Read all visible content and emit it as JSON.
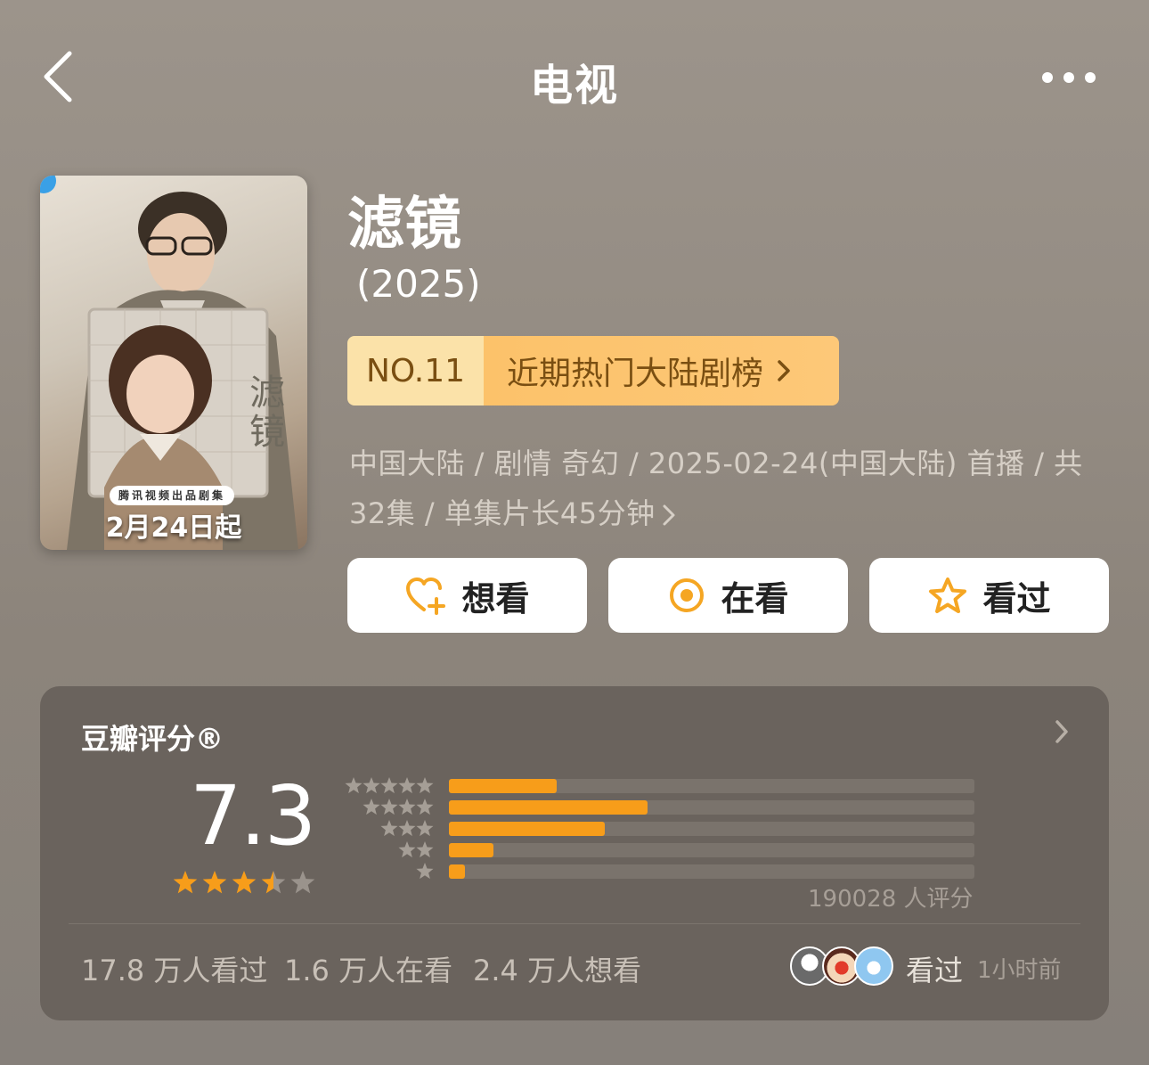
{
  "header": {
    "title": "电视",
    "back_icon": "chevron-left-icon",
    "more_icon": "more-dots-icon"
  },
  "poster": {
    "title_art": "滤镜",
    "tag": "腾讯视频出品剧集",
    "date_text": "2月24日起"
  },
  "show": {
    "title": "滤镜",
    "year": "(2025)",
    "rank": {
      "no": "NO.11",
      "label": "近期热门大陆剧榜"
    },
    "meta": "中国大陆 / 剧情 奇幻 / 2025-02-24(中国大陆) 首播 / 共32集 / 单集片长45分钟"
  },
  "actions": {
    "want": {
      "label": "想看",
      "icon": "heart-plus-icon"
    },
    "watching": {
      "label": "在看",
      "icon": "target-icon"
    },
    "watched": {
      "label": "看过",
      "icon": "star-outline-icon"
    }
  },
  "rating": {
    "title": "豆瓣评分®",
    "score": "7.3",
    "stars_value": 3.5,
    "distribution": [
      {
        "stars": 5,
        "fraction": 0.205
      },
      {
        "stars": 4,
        "fraction": 0.378
      },
      {
        "stars": 3,
        "fraction": 0.297
      },
      {
        "stars": 2,
        "fraction": 0.085
      },
      {
        "stars": 1,
        "fraction": 0.03
      }
    ],
    "count": "190028 人评分",
    "stats": {
      "watched": "17.8 万人看过",
      "watching": "1.6 万人在看",
      "want": "2.4 万人想看"
    },
    "friends": {
      "label": "看过",
      "time": "1小时前"
    }
  },
  "colors": {
    "accent": "#f79d1a",
    "card": "#6a635d",
    "rank_light": "#fbe2a9",
    "rank_dark": "#fcc26a",
    "rank_text": "#7a4f12"
  }
}
